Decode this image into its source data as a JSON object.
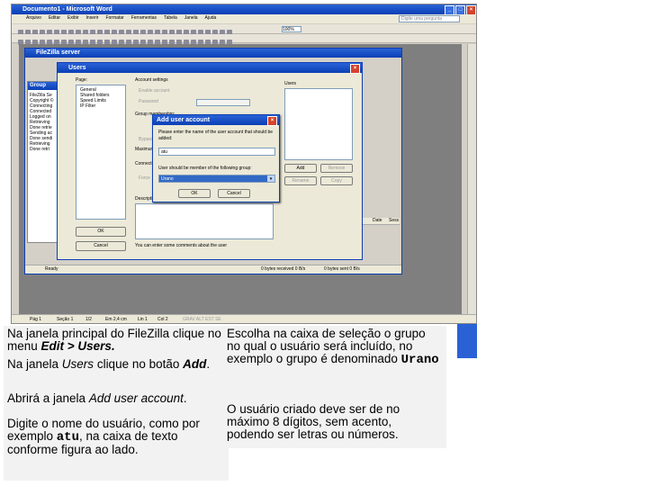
{
  "word": {
    "title": "Documento1 - Microsoft Word",
    "menu": [
      "Arquivo",
      "Editar",
      "Exibir",
      "Inserir",
      "Formatar",
      "Ferramentas",
      "Tabela",
      "Janela",
      "Ajuda"
    ],
    "help_placeholder": "Digite uma pergunta",
    "zoom": "100%",
    "status": {
      "page": "Pág 1",
      "section": "Seção 1",
      "pages": "1/2",
      "pos": "Em 2,4 cm",
      "line": "Lin 1",
      "col": "Col 2",
      "flags": "GRAV  ALT  EST  SE"
    }
  },
  "filezilla": {
    "title": "FileZilla server",
    "log_items": [
      "FileZilla Se",
      "Copyright ©",
      "Connecting",
      "Connected",
      "Logged on",
      "Retrieving",
      "Done retrie",
      "Sending ac",
      "Done sendi",
      "Retrieving",
      "Done retri"
    ],
    "group_title": "Group",
    "id_header": "ID",
    "right_headers": [
      "Date",
      "Sess"
    ],
    "status_bytes_recv": "0 bytes received  0 B/s",
    "status_bytes_sent": "0 bytes sent  0 B/s",
    "status_ready": "Ready"
  },
  "users_dialog": {
    "title": "Users",
    "page_label": "Page:",
    "pages": [
      "General",
      "Shared folders",
      "Speed Limits",
      "IP Filter"
    ],
    "account_settings": "Account settings",
    "enable_account": "Enable account",
    "password": "Password",
    "group_membership": "Group membership:",
    "bypass": "Bypass",
    "maximum": "Maximum",
    "connection": "Connection",
    "force": "Force",
    "description": "Description",
    "comment_hint": "You can enter some comments about the user",
    "users_label": "Users",
    "add": "Add",
    "remove": "Remove",
    "rename": "Rename",
    "copy": "Copy",
    "ok": "OK",
    "cancel": "Cancel"
  },
  "add_user": {
    "title": "Add user account",
    "prompt": "Please enter the name of the user account that should be added:",
    "username": "atu",
    "group_prompt": "User should be member of the following group:",
    "group_value": "Urano",
    "ok": "OK",
    "cancel": "Cancel"
  },
  "instructions": {
    "p1_a": "Na janela principal do FileZilla clique no menu ",
    "p1_b": "Edit > Users.",
    "p2_a": "Na janela ",
    "p2_b": "Users",
    "p2_c": " clique no botão ",
    "p2_d": "Add",
    "p2_e": ".",
    "p3_a": "Abrirá a janela ",
    "p3_b": "Add user account",
    "p3_c": ".",
    "p4_a": "Digite o nome do usuário, como por exemplo ",
    "p4_b": "atu",
    "p4_c": ", na caixa de texto conforme figura ao lado.",
    "r1_a": "Escolha na caixa de seleção o grupo no qual o usuário será incluído, no exemplo o grupo é denominado ",
    "r1_b": "Urano",
    "r2": "O usuário criado deve ser de no máximo 8 dígitos, sem acento, podendo ser letras ou números."
  }
}
